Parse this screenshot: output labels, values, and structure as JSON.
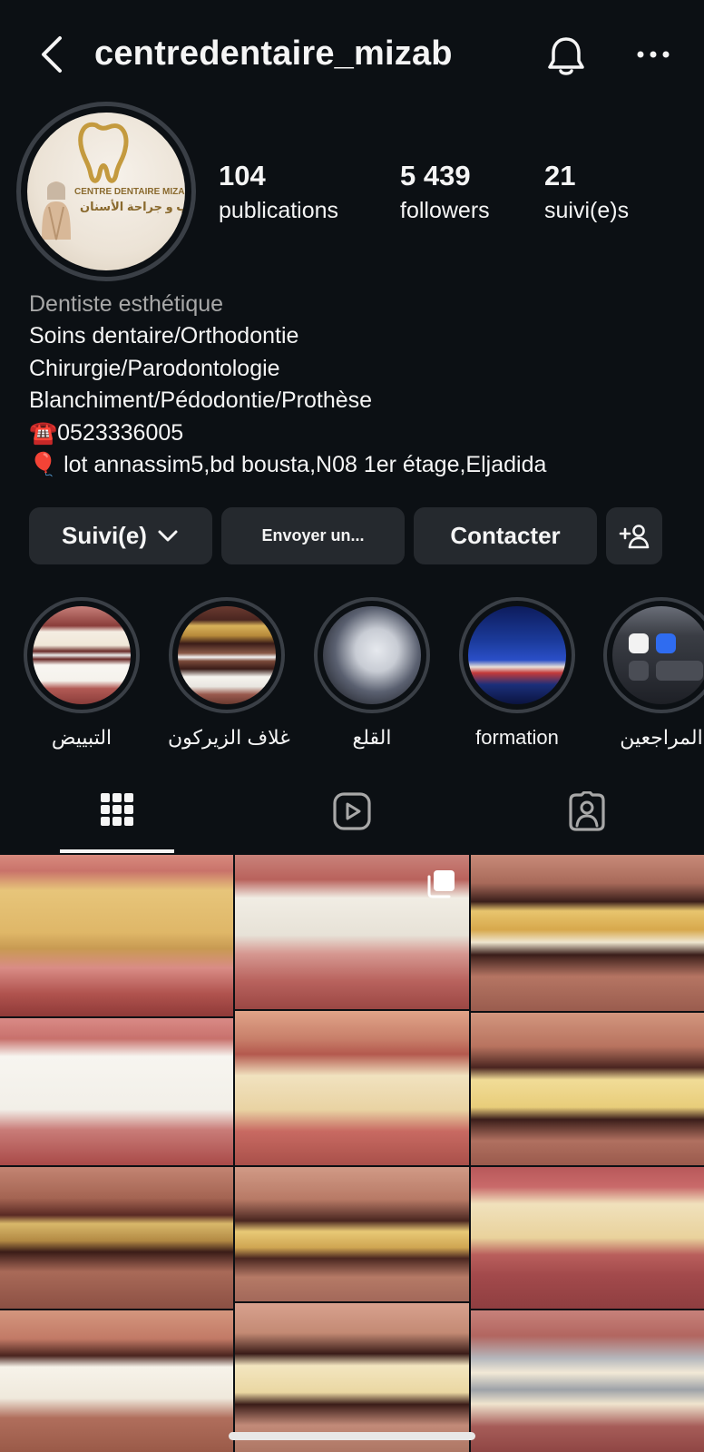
{
  "header": {
    "username": "centredentaire_mizab"
  },
  "profile": {
    "avatar": {
      "logo_line1": "CENTRE DENTAIRE MIZAB",
      "logo_line2": "طب و جراحة الأسنان"
    },
    "stats": [
      {
        "value": "104",
        "label": "publications"
      },
      {
        "value": "5 439",
        "label": "followers"
      },
      {
        "value": "21",
        "label": "suivi(e)s"
      }
    ],
    "bio": {
      "category": "Dentiste esthétique",
      "lines": [
        "Soins dentaire/Orthodontie",
        "Chirurgie/Parodontologie",
        "Blanchiment/Pédodontie/Prothèse",
        "☎️0523336005",
        "🎈 lot annassim5,bd bousta,N08 1er étage,Eljadida"
      ]
    }
  },
  "actions": {
    "following_label": "Suivi(e)",
    "message_label": "Envoyer un...",
    "contact_label": "Contacter"
  },
  "highlights": [
    {
      "label": "التبييض"
    },
    {
      "label": "غلاف الزيركون"
    },
    {
      "label": "القلع"
    },
    {
      "label": "formation"
    },
    {
      "label": "المراجعين"
    }
  ],
  "tabs": [
    "grid-icon",
    "reels-icon",
    "tagged-icon"
  ],
  "colors": {
    "background": "#0c1014",
    "button": "#25292e",
    "ring": "#3a3f46",
    "muted_text": "#a8a8a8"
  }
}
